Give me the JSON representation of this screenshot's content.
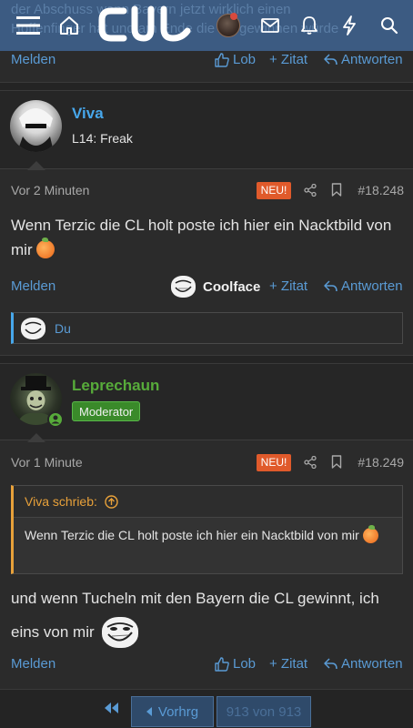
{
  "topbar": {
    "bleed_lines": [
      "der Abschuss wenn Bayern jetzt wirklich einen",
      "Hoffenfinger hat und am Ende die CL gewinnen würde"
    ],
    "logo_text": "CJJ"
  },
  "actions": {
    "report": "Melden",
    "like": "Lob",
    "quote": "+ Zitat",
    "reply": "Antworten"
  },
  "posts": [
    {
      "username": "Viva",
      "username_color": "#47a7eb",
      "user_title": "L14: Freak",
      "time": "Vor 2 Minuten",
      "new_badge": "NEU!",
      "post_number": "#18.248",
      "body": "Wenn Terzic die CL holt poste ich hier ein Nacktbild von mir",
      "reaction": "Coolface",
      "reaction_user": "Du"
    },
    {
      "username": "Leprechaun",
      "username_color": "#57ab3a",
      "badge": "Moderator",
      "time": "Vor 1 Minute",
      "new_badge": "NEU!",
      "post_number": "#18.249",
      "quote_author": "Viva schrieb:",
      "quote_text": "Wenn Terzic die CL holt poste ich hier ein Nacktbild von mir",
      "body_line1": "und wenn Tucheln mit den Bayern die CL gewinnt, ich",
      "body_line2": "eins von mir"
    }
  ],
  "pager": {
    "prev": "Vorhrg",
    "page": "913 von 913"
  },
  "colors": {
    "link": "#5a9bd5",
    "accent": "#3c5b82",
    "new_badge": "#e05a2b",
    "quote_border": "#e8a13a",
    "moderator": "#3a8a2a"
  }
}
